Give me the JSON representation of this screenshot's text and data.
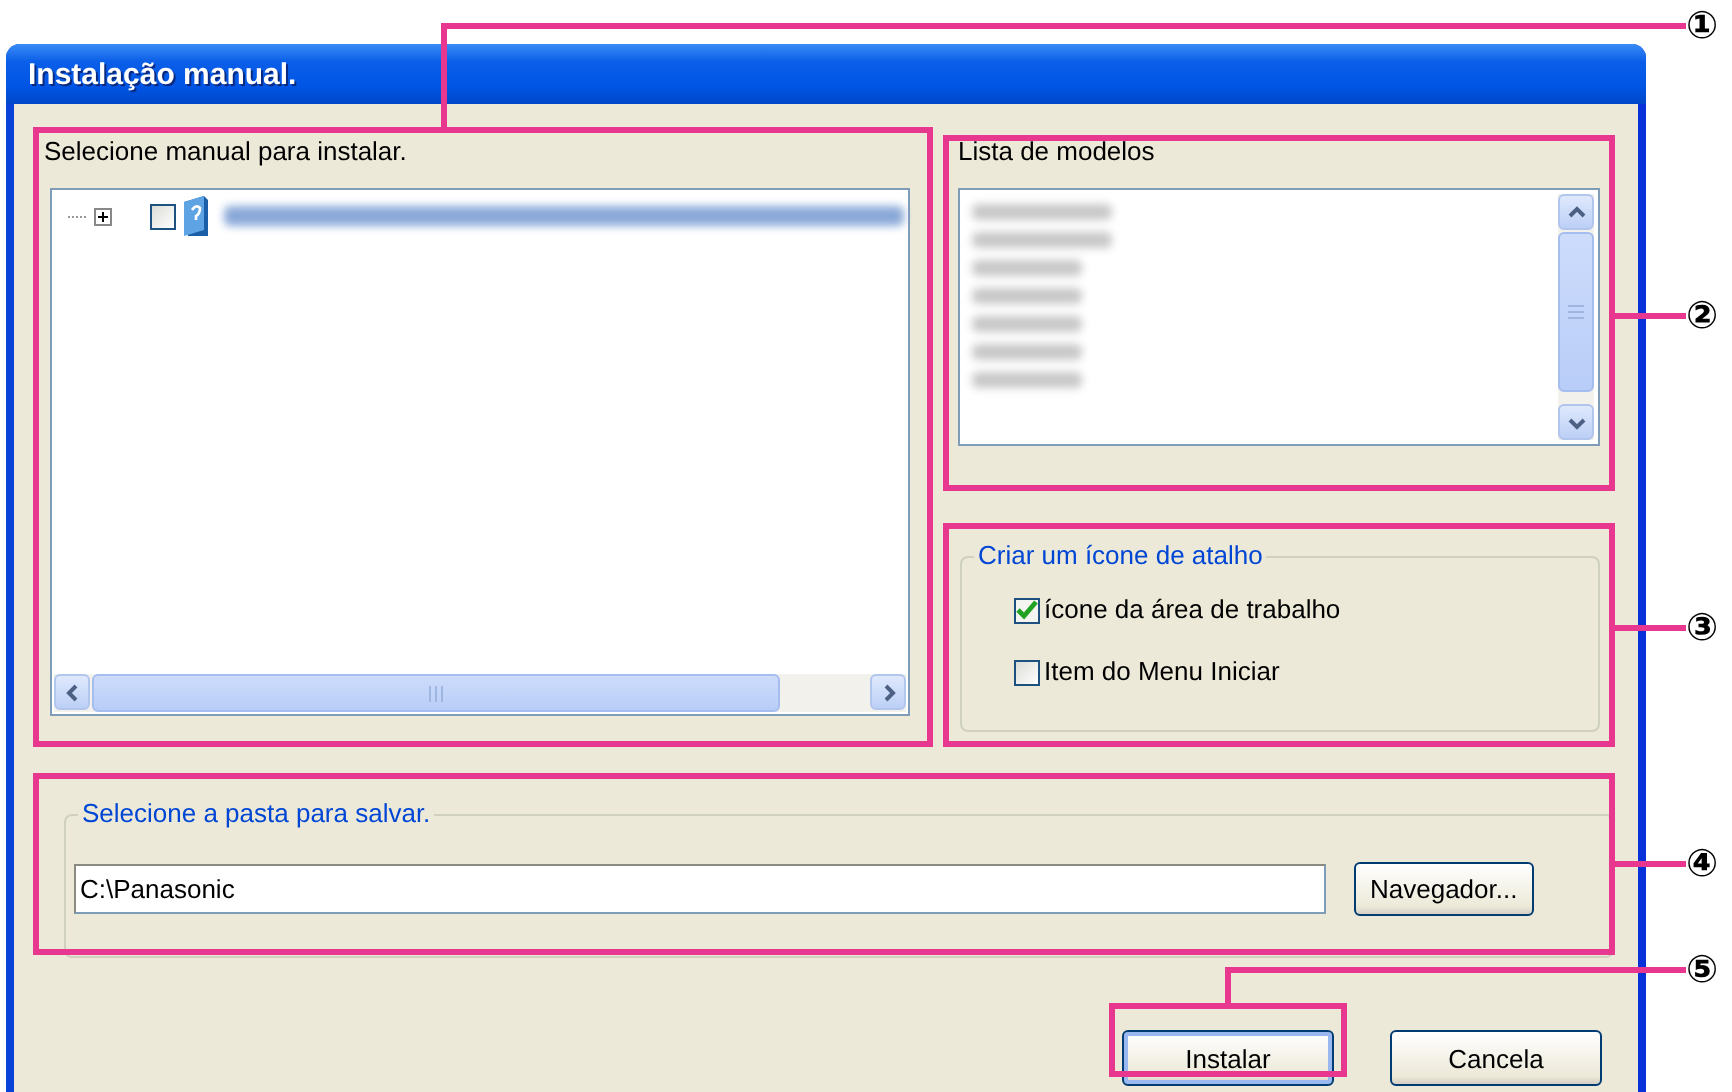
{
  "window": {
    "title": "Instalação manual."
  },
  "manual_tree": {
    "label": "Selecione manual para instalar.",
    "items": [
      {
        "expanded": false,
        "checked": false
      }
    ]
  },
  "model_list": {
    "label": "Lista de modelos"
  },
  "shortcut_group": {
    "title": "Criar um ícone de atalho",
    "options": [
      {
        "label": "ícone da área de trabalho",
        "checked": true
      },
      {
        "label": "Item do Menu Iniciar",
        "checked": false
      }
    ]
  },
  "folder_group": {
    "title": "Selecione a pasta para salvar.",
    "path": "C:\\Panasonic",
    "browse_button": "Navegador..."
  },
  "buttons": [
    {
      "label": "Instalar",
      "default": true
    },
    {
      "label": "Cancela",
      "default": false
    }
  ],
  "callouts": [
    {
      "number": "①"
    },
    {
      "number": "②"
    },
    {
      "number": "③"
    },
    {
      "number": "④"
    },
    {
      "number": "⑤"
    }
  ]
}
